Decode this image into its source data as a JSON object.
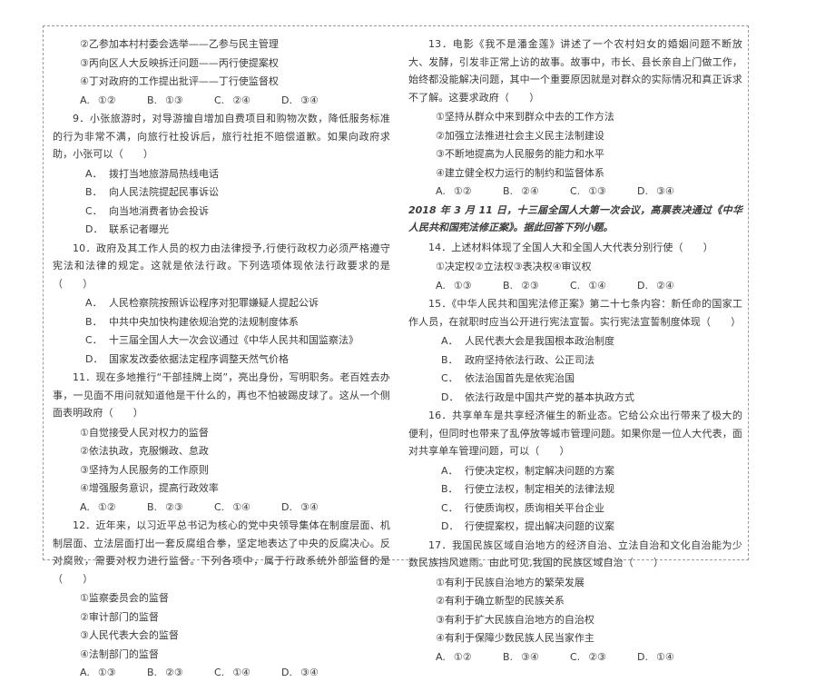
{
  "document": {
    "type": "exam-paper",
    "subject_language": "zh-CN",
    "frame_border_color": "#9a9a9a",
    "text_color": "#3a3a3a"
  },
  "left_column": {
    "items": [
      {
        "kind": "circled-option",
        "text": "②乙参加本村村委会选举——乙参与民主管理"
      },
      {
        "kind": "circled-option",
        "text": "③丙向区人大反映拆迁问题——丙行使提案权"
      },
      {
        "kind": "circled-option",
        "text": "④丁对政府的工作提出批评——丁行使监督权"
      },
      {
        "kind": "answer-row",
        "choices": [
          {
            "key": "A.",
            "value": "①②"
          },
          {
            "key": "B.",
            "value": "①③"
          },
          {
            "key": "C.",
            "value": "②④"
          },
          {
            "key": "D.",
            "value": "③④"
          }
        ]
      },
      {
        "kind": "stem",
        "text": "9．小张旅游时，对导游擅自增加自费项目和购物次数，降低服务标准的行为非常不满，向旅行社投诉后，旅行社拒不赔偿道歉。如果向政府求助，小张可以（　　）"
      },
      {
        "kind": "letter-option",
        "label": "A．",
        "text": "拨打当地旅游局热线电话"
      },
      {
        "kind": "letter-option",
        "label": "B．",
        "text": "向人民法院提起民事诉讼"
      },
      {
        "kind": "letter-option",
        "label": "C．",
        "text": "向当地消费者协会投诉"
      },
      {
        "kind": "letter-option",
        "label": "D．",
        "text": "联系记者曝光"
      },
      {
        "kind": "stem",
        "text": "10．政府及其工作人员的权力由法律授予,行使行政权力必须严格遵守宪法和法律的规定。这就是依法行政。下列选项体现依法行政要求的是（　　）"
      },
      {
        "kind": "letter-option",
        "label": "A．",
        "text": "人民检察院按照诉讼程序对犯罪嫌疑人提起公诉"
      },
      {
        "kind": "letter-option",
        "label": "B．",
        "text": "中共中央加快构建依规治党的法规制度体系"
      },
      {
        "kind": "letter-option",
        "label": "C．",
        "text": "十三届全国人大一次会议通过《中华人民共和国监察法》"
      },
      {
        "kind": "letter-option",
        "label": "D．",
        "text": "国家发改委依据法定程序调整天然气价格"
      },
      {
        "kind": "stem",
        "text": "11．现在多地推行“干部挂牌上岗”，亮出身份，写明职务。老百姓去办事，一见面不用问就知道他是干什么的，再也不怕被踢皮球了。这从一个侧面表明政府（　　）"
      },
      {
        "kind": "circled-option",
        "text": "①自觉接受人民对权力的监督"
      },
      {
        "kind": "circled-option",
        "text": "②依法执政，克服懒政、怠政"
      },
      {
        "kind": "circled-option",
        "text": "③坚持为人民服务的工作原则"
      },
      {
        "kind": "circled-option",
        "text": "④增强服务意识，提高行政效率"
      },
      {
        "kind": "answer-row",
        "choices": [
          {
            "key": "A.",
            "value": "①②"
          },
          {
            "key": "B.",
            "value": "②③"
          },
          {
            "key": "C.",
            "value": "①④"
          },
          {
            "key": "D.",
            "value": "③④"
          }
        ]
      },
      {
        "kind": "stem",
        "text": "12．近年来，以习近平总书记为核心的党中央领导集体在制度层面、机制层面、立法层面打出一套反腐组合拳，坚定地表达了中央的反腐决心。反对腐败，需要对权力进行监督。下列各项中，属于行政系统外部监督的是（　　）"
      },
      {
        "kind": "circled-option",
        "text": "①监察委员会的监督"
      },
      {
        "kind": "circled-option",
        "text": "②审计部门的监督"
      },
      {
        "kind": "circled-option",
        "text": "③人民代表大会的监督"
      },
      {
        "kind": "circled-option",
        "text": "④法制部门的监督"
      },
      {
        "kind": "answer-row",
        "choices": [
          {
            "key": "A.",
            "value": "①③"
          },
          {
            "key": "B.",
            "value": "②③"
          },
          {
            "key": "C.",
            "value": "①④"
          },
          {
            "key": "D.",
            "value": "③④"
          }
        ]
      }
    ]
  },
  "right_column": {
    "items": [
      {
        "kind": "stem",
        "text": "13．电影《我不是潘金莲》讲述了一个农村妇女的婚姻问题不断放大、发酵，引发非正常上访的故事。故事中，市长、县长亲自上门做工作，始终都没能解决问题，其中一个重要原因就是对群众的实际情况和真正诉求不了解。这要求政府（　　）"
      },
      {
        "kind": "circled-option",
        "text": "①坚持从群众中来到群众中去的工作方法"
      },
      {
        "kind": "circled-option",
        "text": "②加强立法推进社会主义民主法制建设"
      },
      {
        "kind": "circled-option",
        "text": "③不断地提高为人民服务的能力和水平"
      },
      {
        "kind": "circled-option",
        "text": "④建立健全权力运行的制约和监督体系"
      },
      {
        "kind": "answer-row",
        "choices": [
          {
            "key": "A.",
            "value": "①②"
          },
          {
            "key": "B.",
            "value": "②④"
          },
          {
            "key": "C.",
            "value": "①③"
          },
          {
            "key": "D.",
            "value": "③④"
          }
        ]
      },
      {
        "kind": "material",
        "text": "2018 年 3 月 11 日，十三届全国人大第一次会议，高票表决通过《中华人民共和国宪法修正案》。据此回答下列小题。"
      },
      {
        "kind": "stem",
        "text": "14．上述材料体现了全国人大和全国人大代表分别行使（　　）"
      },
      {
        "kind": "circled-option",
        "text": "①决定权②立法权③表决权④审议权"
      },
      {
        "kind": "answer-row",
        "choices": [
          {
            "key": "A.",
            "value": "①③"
          },
          {
            "key": "B.",
            "value": "②③"
          },
          {
            "key": "C.",
            "value": "①④"
          },
          {
            "key": "D.",
            "value": "②④"
          }
        ]
      },
      {
        "kind": "stem",
        "text": "15．《中华人民共和国宪法修正案》第二十七条内容：新任命的国家工作人员，在就职时应当公开进行宪法宣誓。实行宪法宣誓制度体现（　　）"
      },
      {
        "kind": "letter-option",
        "label": "A．",
        "text": "人民代表大会是我国根本政治制度"
      },
      {
        "kind": "letter-option",
        "label": "B．",
        "text": "政府坚持依法行政、公正司法"
      },
      {
        "kind": "letter-option",
        "label": "C．",
        "text": "依法治国首先是依宪治国"
      },
      {
        "kind": "letter-option",
        "label": "D．",
        "text": "依法行政是中国共产党的基本执政方式"
      },
      {
        "kind": "stem",
        "text": "16．共享单车是共享经济催生的新业态。它给公众出行带来了极大的便利，但同时也带来了乱停放等城市管理问题。如果你是一位人大代表，面对共享单车管理问题，可以（　　）"
      },
      {
        "kind": "letter-option",
        "label": "A．",
        "text": "行使决定权，制定解决问题的方案"
      },
      {
        "kind": "letter-option",
        "label": "B．",
        "text": "行使立法权，制定相关的法律法规"
      },
      {
        "kind": "letter-option",
        "label": "C．",
        "text": "行使质询权，质询相关平台企业"
      },
      {
        "kind": "letter-option",
        "label": "D．",
        "text": "行使提案权，提出解决问题的议案"
      },
      {
        "kind": "stem",
        "text": "17．我国民族区域自治地方的经济自治、立法自治和文化自治能为少数民族挡风遮雨。由此可见,我国的民族区域自治（　　）"
      },
      {
        "kind": "circled-option",
        "text": "①有利于民族自治地方的繁荣发展"
      },
      {
        "kind": "circled-option",
        "text": "②有利于确立新型的民族关系"
      },
      {
        "kind": "circled-option",
        "text": "③有利于扩大民族自治地方的自治权"
      },
      {
        "kind": "circled-option",
        "text": "④有利于保障少数民族人民当家作主"
      },
      {
        "kind": "answer-row",
        "choices": [
          {
            "key": "A.",
            "value": "①②"
          },
          {
            "key": "B.",
            "value": "③④"
          },
          {
            "key": "C.",
            "value": "②③"
          },
          {
            "key": "D.",
            "value": "①④"
          }
        ]
      }
    ]
  }
}
